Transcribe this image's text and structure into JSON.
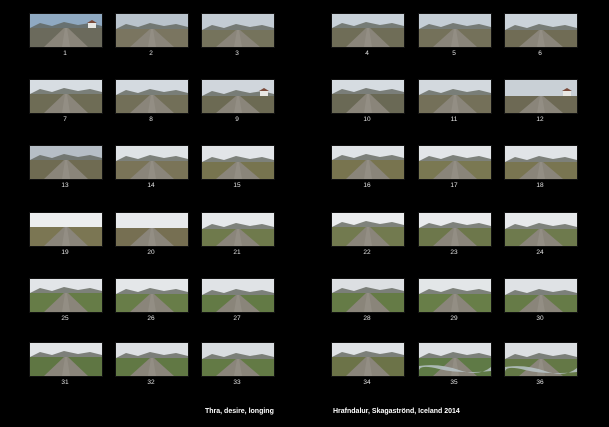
{
  "title": "Thra, desire, longing",
  "subtitle": "Hrafndalur, Skagaströnd, Iceland 2014",
  "frames": [
    {
      "label": "1",
      "sky": "#8fa9c2",
      "land": "#6b6a5c",
      "mountain": true,
      "building": true
    },
    {
      "label": "2",
      "sky": "#b9c3cc",
      "land": "#7a7560",
      "mountain": true,
      "building": false
    },
    {
      "label": "3",
      "sky": "#c3ccd4",
      "land": "#75735c",
      "mountain": true,
      "building": false
    },
    {
      "label": "4",
      "sky": "#c8d1d8",
      "land": "#6f6d57",
      "mountain": true,
      "building": false
    },
    {
      "label": "5",
      "sky": "#c5ced6",
      "land": "#74715a",
      "mountain": true,
      "building": false
    },
    {
      "label": "6",
      "sky": "#cbd3da",
      "land": "#706c55",
      "mountain": true,
      "building": false
    },
    {
      "label": "7",
      "sky": "#d7dde2",
      "land": "#6e6c55",
      "mountain": true,
      "building": false
    },
    {
      "label": "8",
      "sky": "#d4dae0",
      "land": "#726f58",
      "mountain": true,
      "building": false
    },
    {
      "label": "9",
      "sky": "#d0d6dc",
      "land": "#6c6a53",
      "mountain": true,
      "building": true
    },
    {
      "label": "10",
      "sky": "#d6dce1",
      "land": "#6a6955",
      "mountain": true,
      "building": false
    },
    {
      "label": "11",
      "sky": "#d3d9de",
      "land": "#747059",
      "mountain": true,
      "building": false
    },
    {
      "label": "12",
      "sky": "#c9d0d6",
      "land": "#6d6954",
      "mountain": false,
      "building": true
    },
    {
      "label": "13",
      "sky": "#b6bec6",
      "land": "#6f6b52",
      "mountain": true,
      "building": false
    },
    {
      "label": "14",
      "sky": "#dfe3e6",
      "land": "#7a7458",
      "mountain": true,
      "building": false
    },
    {
      "label": "15",
      "sky": "#e2e5e8",
      "land": "#77744f",
      "mountain": true,
      "building": false
    },
    {
      "label": "16",
      "sky": "#e0e4e7",
      "land": "#78744f",
      "mountain": true,
      "building": false
    },
    {
      "label": "17",
      "sky": "#e3e6e8",
      "land": "#7a7852",
      "mountain": true,
      "building": false
    },
    {
      "label": "18",
      "sky": "#e1e4e7",
      "land": "#797551",
      "mountain": true,
      "building": false
    },
    {
      "label": "19",
      "sky": "#eceeef",
      "land": "#7b7653",
      "mountain": false,
      "building": false
    },
    {
      "label": "20",
      "sky": "#e8eaec",
      "land": "#766f52",
      "mountain": false,
      "building": false
    },
    {
      "label": "21",
      "sky": "#e6e9eb",
      "land": "#6f7a4c",
      "mountain": true,
      "building": false
    },
    {
      "label": "22",
      "sky": "#ebedee",
      "land": "#727a4f",
      "mountain": true,
      "building": false
    },
    {
      "label": "23",
      "sky": "#e9ebed",
      "land": "#6d774b",
      "mountain": true,
      "building": false
    },
    {
      "label": "24",
      "sky": "#e7e9eb",
      "land": "#6e7a4d",
      "mountain": true,
      "building": false
    },
    {
      "label": "25",
      "sky": "#e2e5e8",
      "land": "#667c47",
      "mountain": true,
      "building": false
    },
    {
      "label": "26",
      "sky": "#e4e7e9",
      "land": "#687d48",
      "mountain": true,
      "building": false
    },
    {
      "label": "27",
      "sky": "#e0e3e6",
      "land": "#637a45",
      "mountain": true,
      "building": false
    },
    {
      "label": "28",
      "sky": "#dcdfe2",
      "land": "#657b46",
      "mountain": true,
      "building": false
    },
    {
      "label": "29",
      "sky": "#e3e6e8",
      "land": "#687e48",
      "mountain": true,
      "building": false
    },
    {
      "label": "30",
      "sky": "#dfe2e5",
      "land": "#667b47",
      "mountain": true,
      "building": false
    },
    {
      "label": "31",
      "sky": "#e1e4e7",
      "land": "#5f7643",
      "mountain": true,
      "building": false
    },
    {
      "label": "32",
      "sky": "#dde0e3",
      "land": "#617844",
      "mountain": true,
      "building": false
    },
    {
      "label": "33",
      "sky": "#d9dde0",
      "land": "#637a45",
      "mountain": true,
      "building": false
    },
    {
      "label": "34",
      "sky": "#e0e3e6",
      "land": "#6c7348",
      "mountain": true,
      "building": false
    },
    {
      "label": "35",
      "sky": "#dfe2e5",
      "land": "#5f7a46",
      "mountain": true,
      "building": false,
      "river": true
    },
    {
      "label": "36",
      "sky": "#dcdfe2",
      "land": "#647846",
      "mountain": true,
      "building": false,
      "river": true
    }
  ]
}
